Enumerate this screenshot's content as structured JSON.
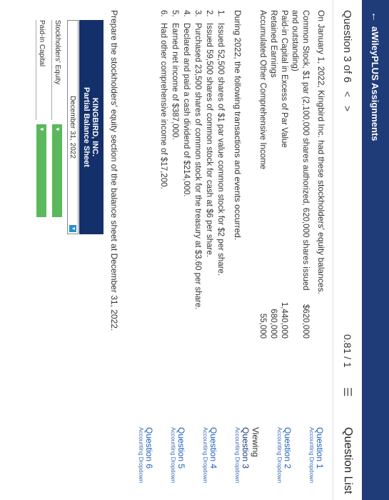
{
  "header": {
    "back_icon": "arrow-left-icon",
    "title": "aWileyPLUS Assignments"
  },
  "subbar": {
    "question_label": "Question 3 of 6",
    "prev": "<",
    "next": ">",
    "score": "0.81 / 1",
    "list_icon": "☰",
    "question_list": "Question List"
  },
  "intro": "On January 1, 2022, Kingbird Inc. had these stockholders' equity balances.",
  "balances": [
    {
      "label": "Common Stock, $1 par (2,100,000 shares authorized, 620,000 shares issued and outstanding)",
      "amount": "$620,000"
    },
    {
      "label": "Paid-in Capital in Excess of Par Value",
      "amount": "1,440,000"
    },
    {
      "label": "Retained Earnings",
      "amount": "680,000"
    },
    {
      "label": "Accumulated Other Comprehensive Income",
      "amount": "55,000"
    }
  ],
  "during": "During 2022, the following transactions and events occurred.",
  "events": [
    {
      "n": "1.",
      "text": "Issued 52,500 shares of $1 par value common stock for $2 per share."
    },
    {
      "n": "2.",
      "text": "Issued 59,500 shares of common stock for cash at $6 per share."
    },
    {
      "n": "3.",
      "text": "Purchased 23,500 shares of common stock for the treasury at $3.60 per share."
    },
    {
      "n": "4.",
      "text": "Declared and paid a cash dividend of $214,000."
    },
    {
      "n": "5.",
      "text": "Earned net income of $387,000."
    },
    {
      "n": "6.",
      "text": "Had other comprehensive income of $17,200."
    }
  ],
  "prepare": "Prepare the stockholders' equity section of the balance sheet at December 31, 2022.",
  "table": {
    "company": "KINGBIRD, INC.",
    "statement": "Partial Balance Sheet",
    "date": "December 31, 2022",
    "rows": [
      {
        "label": "Stockholders' Equity"
      },
      {
        "label": "Paid-in Capital"
      }
    ]
  },
  "sidebar": {
    "q1_title": "Question 1",
    "q1_sub": "Accounting Dropdown",
    "q2_title": "Question 2",
    "q2_sub": "Accounting Dropdown",
    "viewing": "Viewing",
    "q3_title": "Question 3",
    "q3_sub": "Accounting Dropdown",
    "q4_title": "Question 4",
    "q4_sub": "Accounting Dropdown",
    "q5_title": "Question 5",
    "q5_sub": "Accounting Dropdown",
    "q6_title": "Question 6",
    "q6_sub": "Accounting Dropdown"
  },
  "colors": {
    "header": "#1f3b78",
    "table_header": "#13306b",
    "dropdown": "#5cb85c",
    "link": "#1f5fb5"
  }
}
